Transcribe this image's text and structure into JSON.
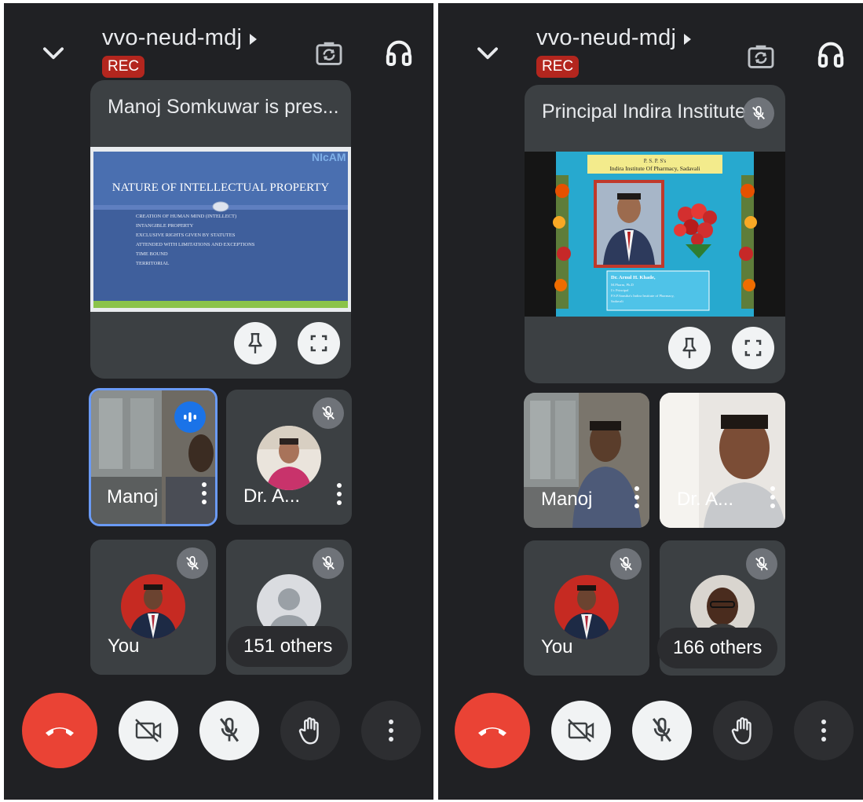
{
  "colors": {
    "background": "#202124",
    "card": "#3c4043",
    "rec": "#b3261e",
    "end_call": "#ea4335",
    "speaking": "#1a73e8",
    "active_border": "#6a9af5"
  },
  "icons": [
    "chevron-down-icon",
    "triangle-right-icon",
    "camera-switch-icon",
    "headphones-icon",
    "pin-icon",
    "fullscreen-icon",
    "mic-off-icon",
    "speaking-icon",
    "more-vert-icon",
    "end-call-icon",
    "camera-off-icon",
    "raise-hand-icon",
    "person-icon"
  ],
  "left": {
    "title": "vvo-neud-mdj",
    "rec": "REC",
    "presenter": "Manoj Somkuwar is pres...",
    "slide": {
      "logo": "NIcAM",
      "title": "NATURE OF INTELLECTUAL PROPERTY",
      "bullets": [
        "CREATION OF HUMAN MIND (INTELLECT)",
        "INTANGIBLE PROPERTY",
        "EXCLUSIVE RIGHTS GIVEN BY STATUTES",
        "ATTENDED WITH LIMITATIONS AND EXCEPTIONS",
        "TIME BOUND",
        "TERRITORIAL"
      ]
    },
    "tiles": {
      "manoj": "Manoj",
      "dr": "Dr. A...",
      "you": "You",
      "others": "151 others"
    }
  },
  "right": {
    "title": "vvo-neud-mdj",
    "rec": "REC",
    "presenter": "Principal Indira Institute",
    "slide": {
      "header1": "P. S. P. S's",
      "header2": "Indira Institute Of Pharmacy, Sadavali",
      "caption_name": "Dr. Arnul H. Khade,",
      "caption_lines": [
        "M.Pharm, Ph.D",
        "I/c Principal",
        "P.S.P.Sanstha's Indira Institute of Pharmacy,",
        "Sadavali"
      ]
    },
    "tiles": {
      "manoj": "Manoj",
      "dr": "Dr. A...",
      "you": "You",
      "others": "166 others"
    }
  }
}
